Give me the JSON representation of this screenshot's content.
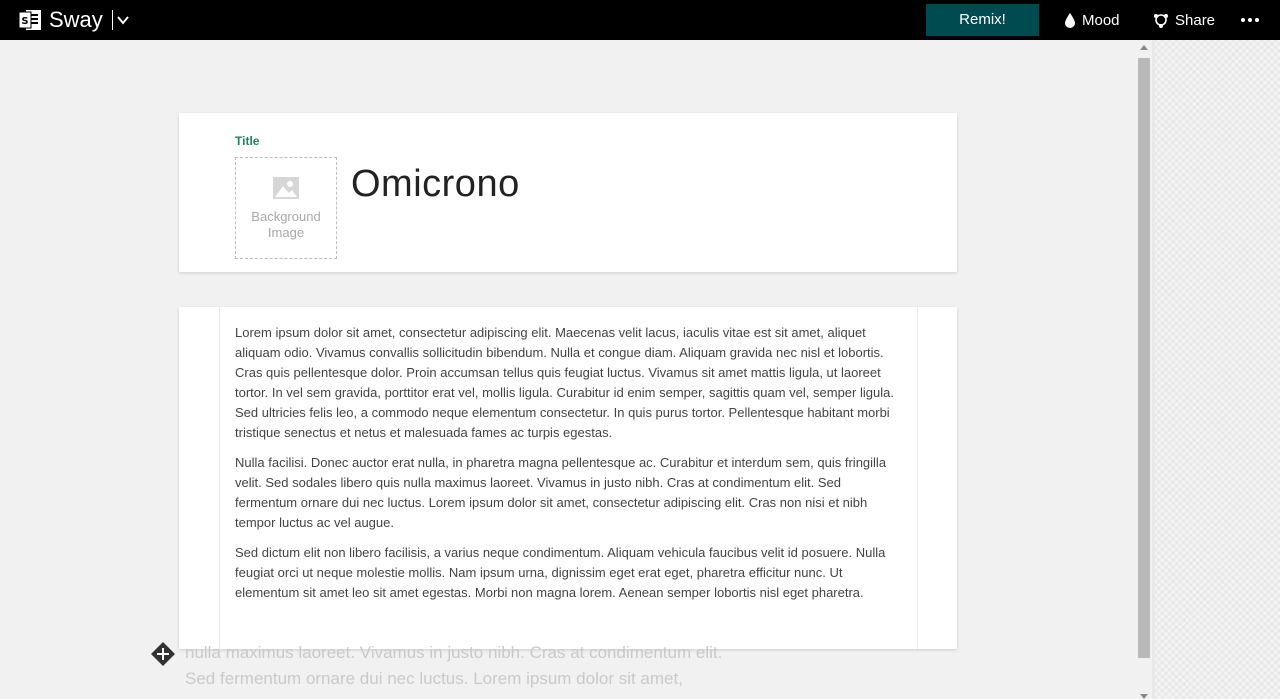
{
  "app": {
    "name": "Sway"
  },
  "toolbar": {
    "remix_label": "Remix!",
    "mood_label": "Mood",
    "share_label": "Share"
  },
  "title_card": {
    "label": "Title",
    "bg_image_line1": "Background",
    "bg_image_line2": "Image",
    "title": "Omicrono"
  },
  "text_card": {
    "paragraphs": [
      "Lorem ipsum dolor sit amet, consectetur adipiscing elit. Maecenas velit lacus, iaculis vitae est sit amet, aliquet aliquam odio. Vivamus convallis sollicitudin bibendum. Nulla et congue diam. Aliquam gravida nec nisl et lobortis. Cras quis pellentesque dolor. Proin accumsan tellus quis feugiat luctus. Vivamus sit amet mattis ligula, ut laoreet tortor. In vel sem gravida, porttitor erat vel, mollis ligula. Curabitur id enim semper, sagittis quam vel, semper ligula. Sed ultricies felis leo, a commodo neque elementum consectetur. In quis purus tortor. Pellentesque habitant morbi tristique senectus et netus et malesuada fames ac turpis egestas.",
      "Nulla facilisi. Donec auctor erat nulla, in pharetra magna pellentesque ac. Curabitur et interdum sem, quis fringilla velit. Sed sodales libero quis nulla maximus laoreet. Vivamus in justo nibh. Cras at condimentum elit. Sed fermentum ornare dui nec luctus. Lorem ipsum dolor sit amet, consectetur adipiscing elit. Cras non nisi et nibh tempor luctus ac vel augue.",
      "Sed dictum elit non libero facilisis, a varius neque condimentum. Aliquam vehicula faucibus velit id posuere. Nulla feugiat orci ut neque molestie mollis. Nam ipsum urna, dignissim eget erat eget, pharetra efficitur nunc. Ut elementum sit amet leo sit amet egestas. Morbi non magna lorem. Aenean semper lobortis nisl eget pharetra."
    ]
  },
  "ghost_text": {
    "line1": "nulla maximus laoreet. Vivamus in justo nibh. Cras at condimentum elit.",
    "line2": "Sed fermentum ornare dui nec luctus. Lorem ipsum dolor sit amet,"
  },
  "colors": {
    "accent": "#004b50",
    "title_label": "#21815e"
  }
}
